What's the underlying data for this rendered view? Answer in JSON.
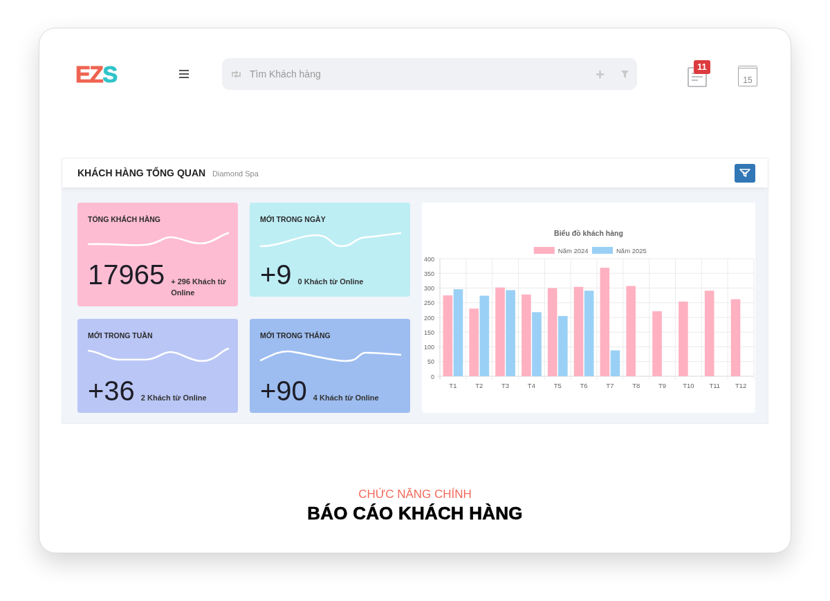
{
  "header": {
    "logo": [
      {
        "text": "EZ",
        "color": "#ef6351"
      },
      {
        "text": "S",
        "color": "#2ec4c9"
      }
    ],
    "search": {
      "placeholder": "Tìm Khách hàng"
    },
    "notifications": {
      "badge": "11"
    },
    "calendar": {
      "day": "15"
    }
  },
  "panel": {
    "title": "KHÁCH HÀNG TỔNG QUAN",
    "subtitle": "Diamond Spa",
    "stats": [
      {
        "title": "TỔNG KHÁCH HÀNG",
        "value": "17965",
        "note": "+ 296 Khách từ Online",
        "color": "#fdbcd2"
      },
      {
        "title": "MỚI TRONG NGÀY",
        "value": "+9",
        "note": "0 Khách từ Online",
        "color": "#bdeef4"
      },
      {
        "title": "MỚI TRONG TUẦN",
        "value": "+36",
        "note": "2 Khách từ Online",
        "color": "#bac6f5"
      },
      {
        "title": "MỚI TRONG THÁNG",
        "value": "+90",
        "note": "4 Khách từ Online",
        "color": "#9dbdf0"
      }
    ],
    "chart": {
      "chart_data": {
        "type": "bar",
        "title": "Biểu đồ khách hàng",
        "legend": "top",
        "grid": true,
        "categories": [
          "T1",
          "T2",
          "T3",
          "T4",
          "T5",
          "T6",
          "T7",
          "T8",
          "T9",
          "T10",
          "T11",
          "T12"
        ],
        "series": [
          {
            "name": "Năm 2024",
            "color": "#ffb1c1",
            "values": [
              275,
              230,
              302,
              278,
              300,
              304,
              369,
              307,
              221,
              254,
              291,
              262
            ]
          },
          {
            "name": "Năm 2025",
            "color": "#9ad0f5",
            "values": [
              296,
              274,
              293,
              218,
              205,
              291,
              88,
              null,
              null,
              null,
              null,
              null
            ]
          }
        ],
        "ylim": [
          0,
          400
        ],
        "yticks": [
          0,
          50,
          100,
          150,
          200,
          250,
          300,
          350,
          400
        ]
      }
    }
  },
  "caption": {
    "kicker": "CHỨC NĂNG CHÍNH",
    "title": "BÁO CÁO KHÁCH HÀNG"
  }
}
